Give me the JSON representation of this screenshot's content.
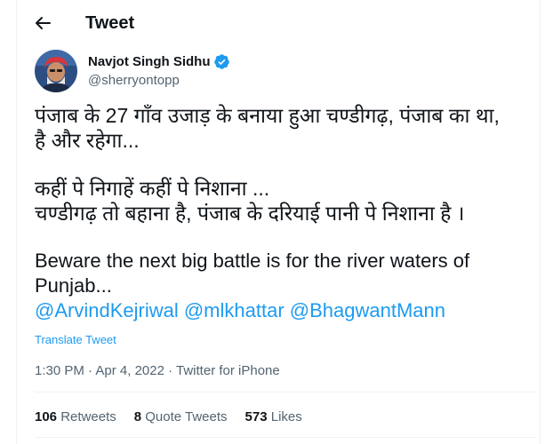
{
  "header": {
    "title": "Tweet",
    "back_icon": "arrow-left-icon"
  },
  "author": {
    "name": "Navjot Singh Sidhu",
    "handle": "@sherryontopp",
    "verified_icon": "verified-badge-icon",
    "accent": "#1d9bf0"
  },
  "tweet": {
    "line1": "पंजाब के 27 गाँव उजाड़ के बनाया हुआ चण्डीगढ़, पंजाब का था,",
    "line2": "है और रहेगा...",
    "line3": "कहीं पे निगाहें कहीं पे निशाना ...",
    "line4": "चण्डीगढ़ तो बहाना है, पंजाब के दरियाई पानी पे निशाना है ।",
    "line5": "Beware the next big battle is for the river waters of",
    "line6": "Punjab...",
    "mentions": [
      "@ArvindKejriwal",
      "@mlkhattar",
      "@BhagwantMann"
    ]
  },
  "translate_label": "Translate Tweet",
  "meta": {
    "time": "1:30 PM",
    "sep1": " · ",
    "date": "Apr 4, 2022",
    "sep2": " · ",
    "source": "Twitter for iPhone"
  },
  "stats": {
    "retweets": {
      "count": "106",
      "label": "Retweets"
    },
    "quotes": {
      "count": "8",
      "label": "Quote Tweets"
    },
    "likes": {
      "count": "573",
      "label": "Likes"
    }
  }
}
